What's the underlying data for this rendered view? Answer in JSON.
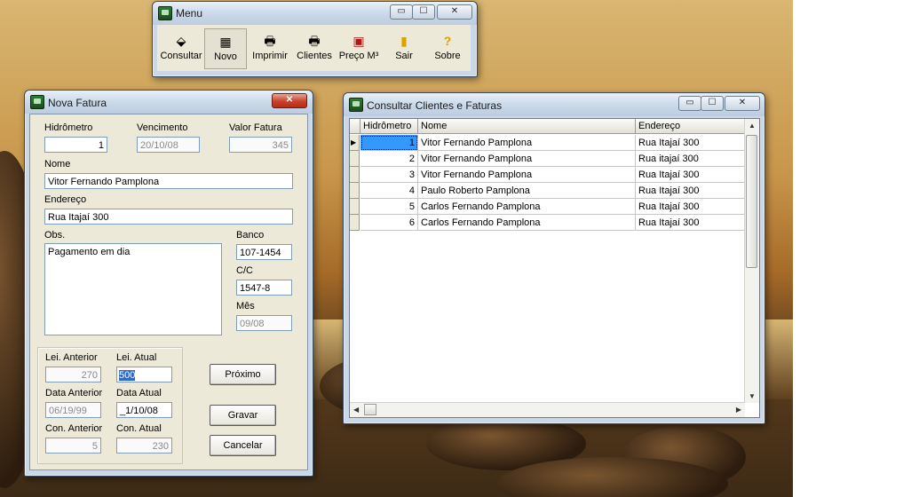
{
  "menu_window": {
    "title": "Menu",
    "controls": {
      "minimize": "▭",
      "maximize": "☐",
      "close": "✕"
    },
    "tools": [
      {
        "label": "Consultar",
        "icon": "eraser-icon",
        "glyph": "⬙"
      },
      {
        "label": "Novo",
        "icon": "new-document-icon",
        "glyph": "▦"
      },
      {
        "label": "Imprimir",
        "icon": "printer-icon",
        "glyph": "🖶"
      },
      {
        "label": "Clientes",
        "icon": "printer-list-icon",
        "glyph": "🖶"
      },
      {
        "label": "Preço M³",
        "icon": "calculator-icon",
        "glyph": "▣"
      },
      {
        "label": "Sair",
        "icon": "exit-door-icon",
        "glyph": "▮"
      },
      {
        "label": "Sobre",
        "icon": "help-icon",
        "glyph": "?"
      }
    ]
  },
  "fatura_window": {
    "title": "Nova Fatura",
    "close": "✕",
    "labels": {
      "hidrometro": "Hidrômetro",
      "vencimento": "Vencimento",
      "valor_fatura": "Valor Fatura",
      "nome": "Nome",
      "endereco": "Endereço",
      "obs": "Obs.",
      "banco": "Banco",
      "cc": "C/C",
      "mes": "Mês",
      "lei_anterior": "Lei. Anterior",
      "lei_atual": "Lei. Atual",
      "data_anterior": "Data Anterior",
      "data_atual": "Data Atual",
      "con_anterior": "Con. Anterior",
      "con_atual": "Con. Atual"
    },
    "values": {
      "hidrometro": "1",
      "vencimento": "20/10/08",
      "valor_fatura": "345",
      "nome": "Vitor Fernando Pamplona",
      "endereco": "Rua Itajaí 300",
      "obs": "Pagamento em dia",
      "banco": "107-1454",
      "cc": "1547-8",
      "mes": "09/08",
      "lei_anterior": "270",
      "lei_atual": "500",
      "data_anterior": "06/19/99",
      "data_atual": "_1/10/08",
      "con_anterior": "5",
      "con_atual": "230"
    },
    "buttons": {
      "proximo": "Próximo",
      "gravar": "Gravar",
      "cancelar": "Cancelar"
    }
  },
  "consulta_window": {
    "title": "Consultar Clientes e Faturas",
    "controls": {
      "minimize": "▭",
      "maximize": "☐",
      "close": "✕"
    },
    "columns": [
      "Hidrômetro",
      "Nome",
      "Endereço"
    ],
    "rows": [
      {
        "hidrometro": "1",
        "nome": "Vitor Fernando Pamplona",
        "endereco": "Rua Itajaí 300"
      },
      {
        "hidrometro": "2",
        "nome": "Vitor Fernando Pamplona",
        "endereco": "Rua itajaí 300"
      },
      {
        "hidrometro": "3",
        "nome": "Vitor Fernando Pamplona",
        "endereco": "Rua Itajaí 300"
      },
      {
        "hidrometro": "4",
        "nome": "Paulo Roberto Pamplona",
        "endereco": "Rua Itajaí 300"
      },
      {
        "hidrometro": "5",
        "nome": "Carlos Fernando Pamplona",
        "endereco": "Rua Itajaí 300"
      },
      {
        "hidrometro": "6",
        "nome": "Carlos Fernando Pamplona",
        "endereco": "Rua Itajaí 300"
      }
    ]
  }
}
